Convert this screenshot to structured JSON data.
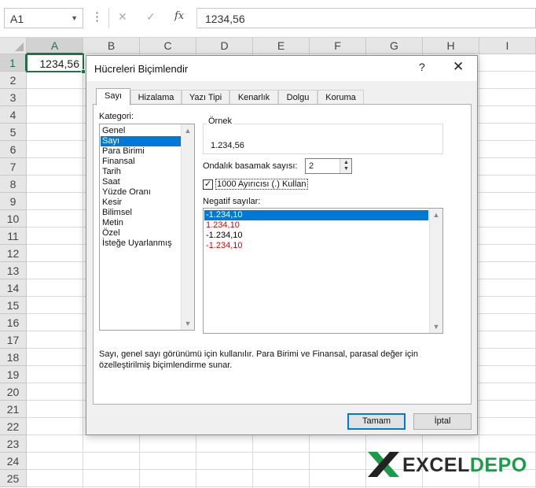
{
  "formula_bar": {
    "name_box": "A1",
    "formula": "1234,56",
    "cancel_icon": "close-icon",
    "enter_icon": "check-icon",
    "fx_label": "fx"
  },
  "grid": {
    "columns": [
      "A",
      "B",
      "C",
      "D",
      "E",
      "F",
      "G",
      "H",
      "I"
    ],
    "rows": [
      "1",
      "2",
      "3",
      "4",
      "5",
      "6",
      "7",
      "8",
      "9",
      "10",
      "11",
      "12",
      "13",
      "14",
      "15",
      "16",
      "17",
      "18",
      "19",
      "20",
      "21",
      "22",
      "23",
      "24",
      "25"
    ],
    "active_cell_value": "1234,56"
  },
  "dialog": {
    "title": "Hücreleri Biçimlendir",
    "help": "?",
    "close": "✕",
    "tabs": [
      "Sayı",
      "Hizalama",
      "Yazı Tipi",
      "Kenarlık",
      "Dolgu",
      "Koruma"
    ],
    "category_label": "Kategori:",
    "categories": [
      "Genel",
      "Sayı",
      "Para Birimi",
      "Finansal",
      "Tarih",
      "Saat",
      "Yüzde Oranı",
      "Kesir",
      "Bilimsel",
      "Metin",
      "Özel",
      "İsteğe Uyarlanmış"
    ],
    "selected_category": "Sayı",
    "sample_label": "Örnek",
    "sample_value": "1.234,56",
    "decimal_label": "Ondalık basamak sayısı:",
    "decimal_value": "2",
    "separator_label": "1000 Ayırıcısı (.) Kullan",
    "separator_checked": true,
    "negative_label": "Negatif sayılar:",
    "negative_options": [
      {
        "text": "-1.234,10",
        "color": "#000000"
      },
      {
        "text": "1.234,10",
        "color": "#e00000"
      },
      {
        "text": "-1.234,10",
        "color": "#000000"
      },
      {
        "text": "-1.234,10",
        "color": "#e00000"
      }
    ],
    "description": "Sayı, genel sayı görünümü için kullanılır. Para Birimi ve Finansal, parasal değer için özelleştirilmiş biçimlendirme sunar.",
    "ok_label": "Tamam",
    "cancel_label": "İptal"
  },
  "logo": {
    "part1": "EXCEL",
    "part2": "DEPO",
    "accent": "#1d9b48"
  }
}
